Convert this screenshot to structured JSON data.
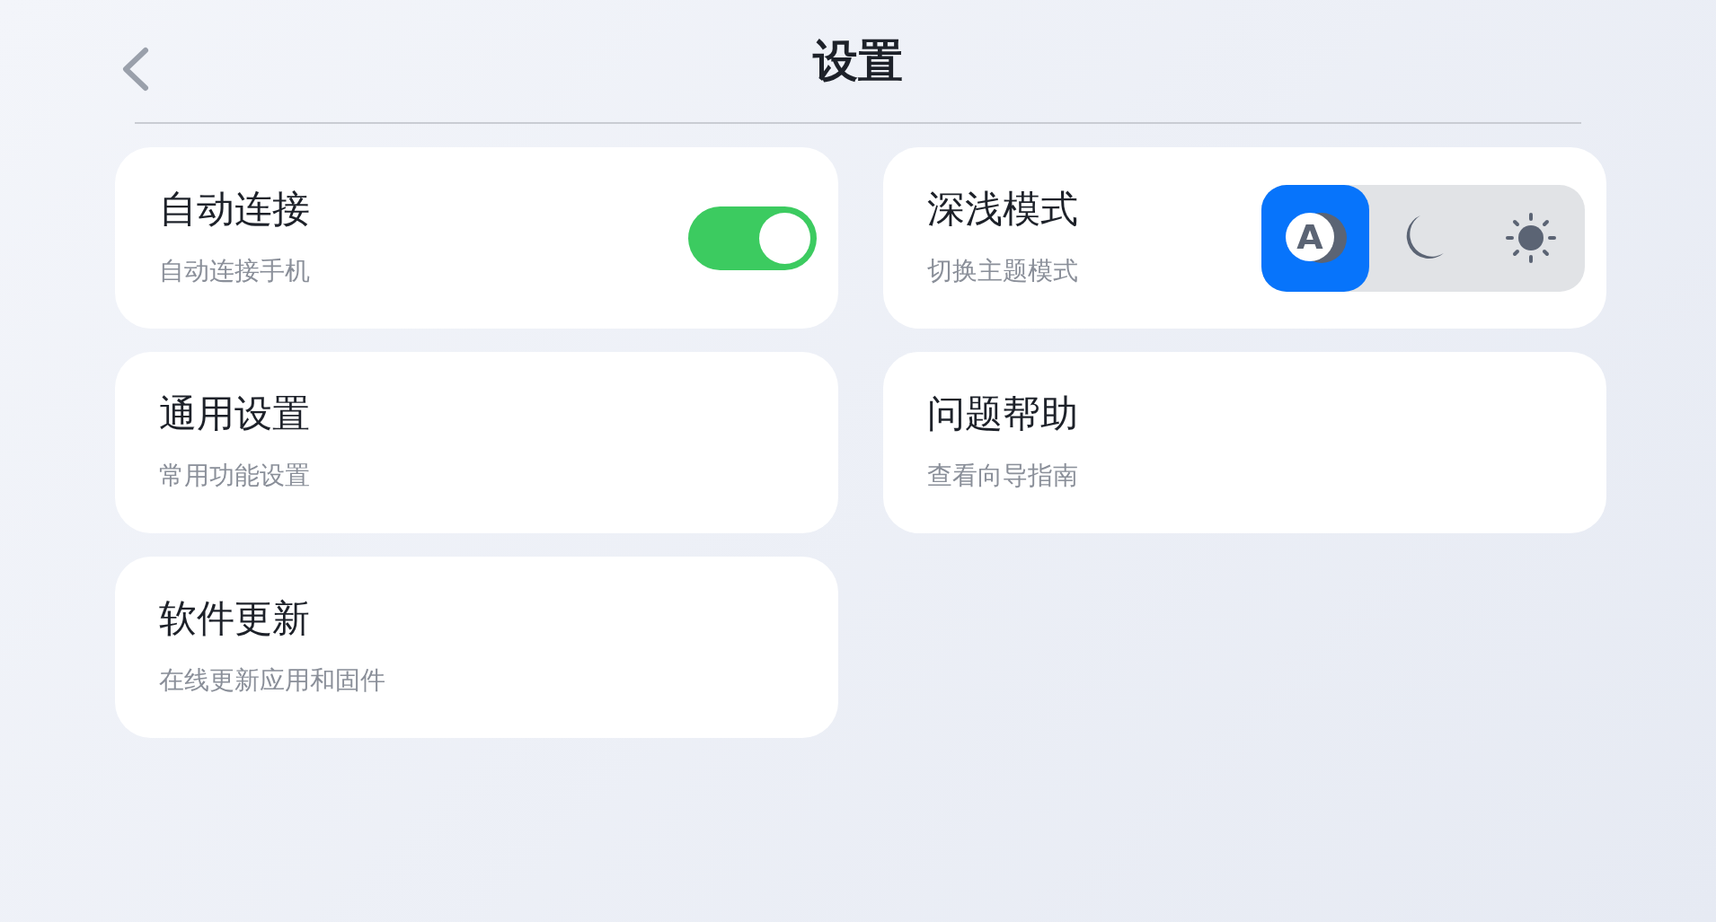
{
  "header": {
    "title": "设置"
  },
  "cards": [
    {
      "kind": "toggle",
      "title": "自动连接",
      "subtitle": "自动连接手机",
      "on": true
    },
    {
      "kind": "theme",
      "title": "深浅模式",
      "subtitle": "切换主题模式",
      "options": [
        {
          "kind": "auto",
          "label": "A",
          "selected": true
        },
        {
          "kind": "dark",
          "selected": false
        },
        {
          "kind": "light",
          "selected": false
        }
      ]
    },
    {
      "kind": "plain",
      "title": "通用设置",
      "subtitle": "常用功能设置"
    },
    {
      "kind": "plain",
      "title": "问题帮助",
      "subtitle": "查看向导指南"
    },
    {
      "kind": "plain",
      "title": "软件更新",
      "subtitle": "在线更新应用和固件"
    }
  ]
}
